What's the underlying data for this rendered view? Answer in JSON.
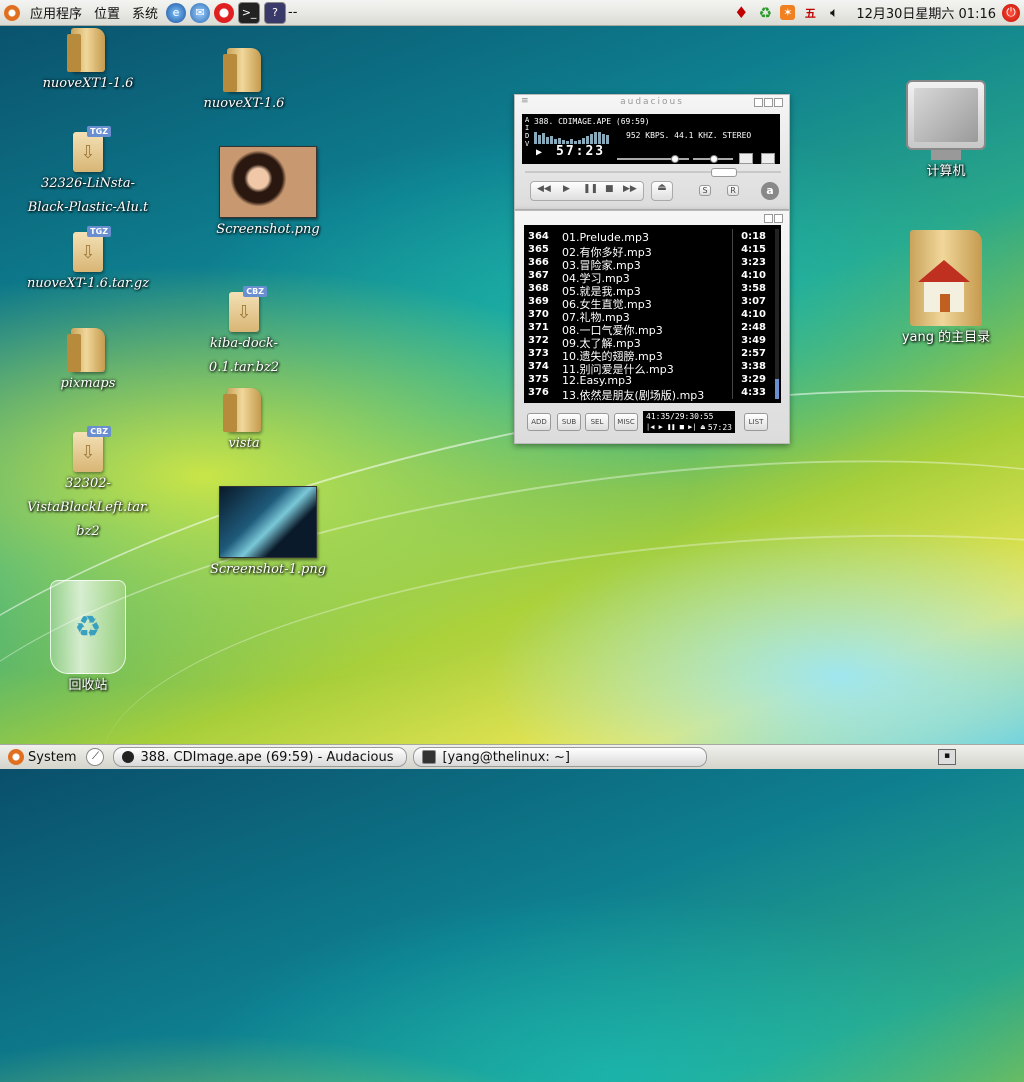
{
  "top_panel": {
    "menus": [
      "应用程序",
      "位置",
      "系统"
    ],
    "launchers": [
      "browser-icon",
      "thunderbird-icon",
      "help-lifebuoy-icon",
      "terminal-icon",
      "help-icon"
    ],
    "separator": "--",
    "tray_icons": [
      "ruby-icon",
      "recycle-icon",
      "update-icon",
      "input-method-icon",
      "volume-icon"
    ],
    "input_method": "五",
    "clock": "12月30日星期六 01:16"
  },
  "desktop": {
    "icons": [
      {
        "label": "nuoveXT1-1.6",
        "type": "folder"
      },
      {
        "label": "nuoveXT-1.6",
        "type": "folder"
      },
      {
        "label": "32326-LiNsta-Black-Plastic-Alu.t",
        "type": "archive",
        "tag": "TGZ"
      },
      {
        "label": "Screenshot.png",
        "type": "image"
      },
      {
        "label": "nuoveXT-1.6.tar.gz",
        "type": "archive",
        "tag": "TGZ"
      },
      {
        "label": "kiba-dock-0.1.tar.bz2",
        "type": "archive",
        "tag": "CBZ"
      },
      {
        "label": "pixmaps",
        "type": "folder"
      },
      {
        "label": "vista",
        "type": "folder"
      },
      {
        "label": "32302-VistaBlackLeft.tar.bz2",
        "type": "archive",
        "tag": "CBZ"
      },
      {
        "label": "Screenshot-1.png",
        "type": "image"
      },
      {
        "label": "回收站",
        "type": "trash"
      },
      {
        "label": "计算机",
        "type": "computer"
      },
      {
        "label": "yang 的主目录",
        "type": "home"
      }
    ]
  },
  "audacious": {
    "title_text": "audacious",
    "track": "388. CDIMAGE.APE (69:59)",
    "bitrate": "952 KBPS. 44.1 KHZ. STEREO",
    "time": "57:23",
    "vis_label": [
      "A",
      "I",
      "D",
      "V"
    ],
    "buttons": [
      "prev",
      "play",
      "pause",
      "stop",
      "next",
      "eject"
    ],
    "toggle_shuffle": "S",
    "toggle_repeat": "R",
    "playlist": [
      {
        "num": "364",
        "title": "01.Prelude.mp3",
        "len": "0:18"
      },
      {
        "num": "365",
        "title": "02.有你多好.mp3",
        "len": "4:15"
      },
      {
        "num": "366",
        "title": "03.冒险家.mp3",
        "len": "3:23"
      },
      {
        "num": "367",
        "title": "04.学习.mp3",
        "len": "4:10"
      },
      {
        "num": "368",
        "title": "05.就是我.mp3",
        "len": "3:58"
      },
      {
        "num": "369",
        "title": "06.女生直觉.mp3",
        "len": "3:07"
      },
      {
        "num": "370",
        "title": "07.礼物.mp3",
        "len": "4:10"
      },
      {
        "num": "371",
        "title": "08.一口气爱你.mp3",
        "len": "2:48"
      },
      {
        "num": "372",
        "title": "09.太了解.mp3",
        "len": "3:49"
      },
      {
        "num": "373",
        "title": "10.遗失的翅膀.mp3",
        "len": "2:57"
      },
      {
        "num": "374",
        "title": "11.别问爱是什么.mp3",
        "len": "3:38"
      },
      {
        "num": "375",
        "title": "12.Easy.mp3",
        "len": "3:29"
      },
      {
        "num": "376",
        "title": "13.依然是朋友(剧场版).mp3",
        "len": "4:33"
      }
    ],
    "pl_buttons": [
      "ADD",
      "SUB",
      "SEL",
      "MISC",
      "LIST"
    ],
    "pl_info": "41:35/29:30:55",
    "pl_time": "57:23"
  },
  "bottom_panel": {
    "system_label": "System",
    "tasks": [
      {
        "label": "388. CDImage.ape (69:59) - Audacious",
        "icon": "audacious-icon"
      },
      {
        "label": "[yang@thelinux: ~]",
        "icon": "terminal-icon"
      }
    ]
  },
  "colors": {
    "panel_bg": "#e6e6e0",
    "accent_orange": "#e07020",
    "lcd_black": "#000000"
  }
}
